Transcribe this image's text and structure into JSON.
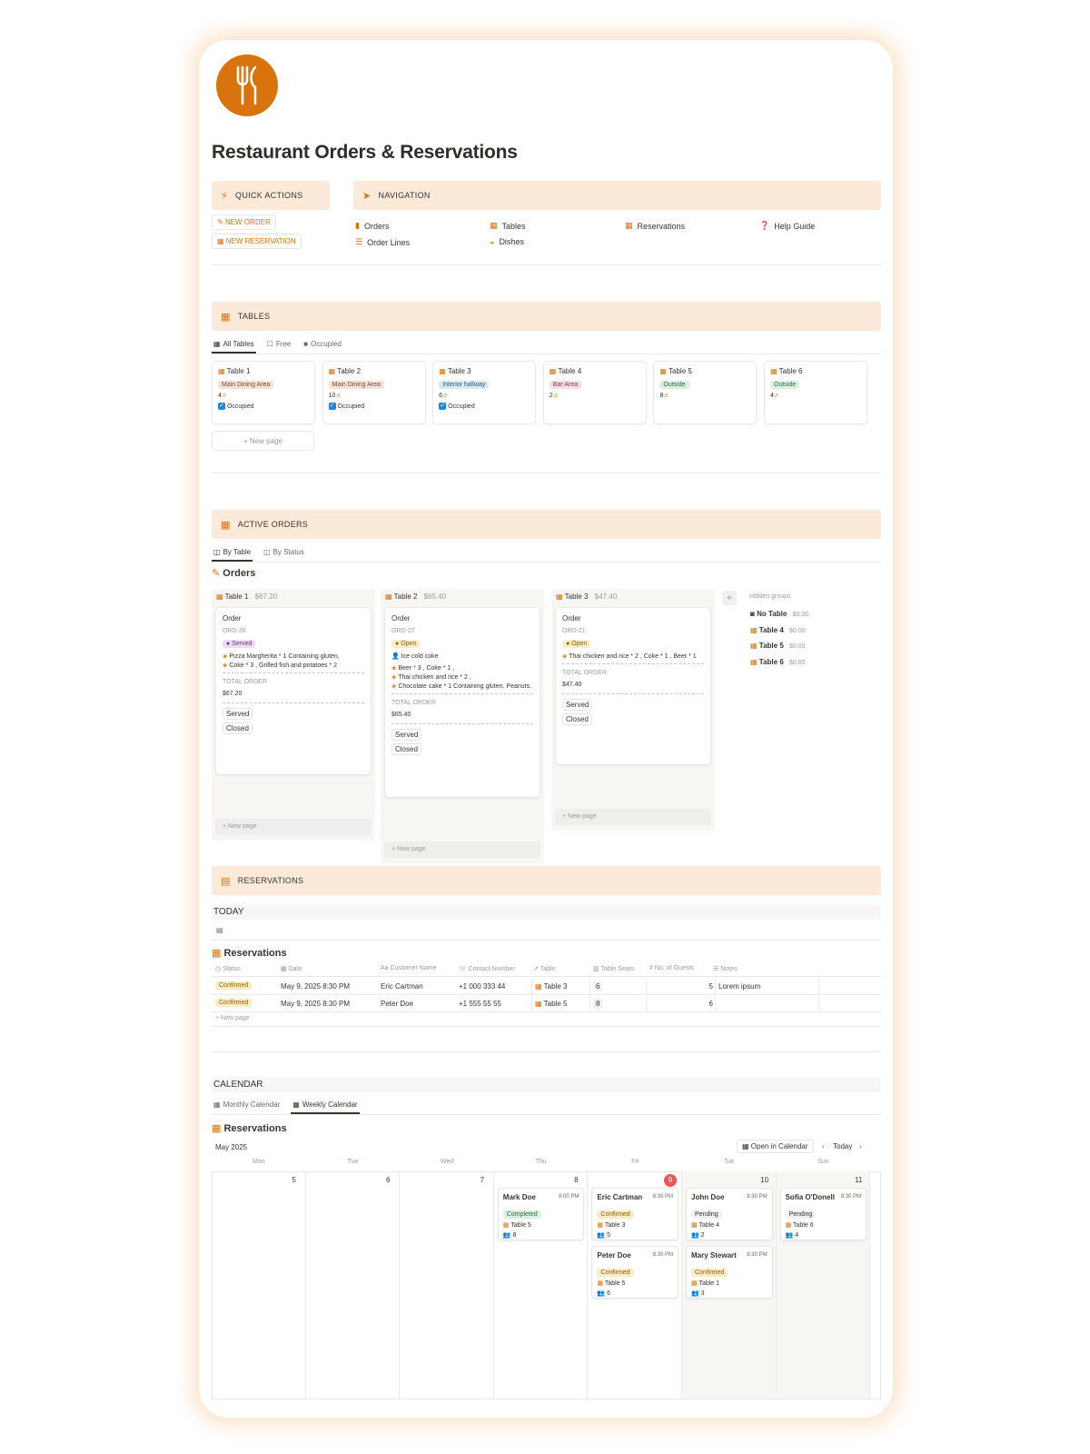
{
  "page": {
    "title": "Restaurant Orders & Reservations"
  },
  "colors": {
    "accent": "#d9730d",
    "section_bg": "#fbe9d9"
  },
  "quick_actions": {
    "title": "QUICK ACTIONS",
    "new_order": "NEW ORDER",
    "new_reservation": "NEW RESERVATION"
  },
  "navigation": {
    "title": "NAVIGATION",
    "orders": "Orders",
    "order_lines": "Order Lines",
    "tables": "Tables",
    "dishes": "Dishes",
    "reservations": "Reservations",
    "help": "Help Guide"
  },
  "tables": {
    "title": "TABLES",
    "tabs": [
      "All Tables",
      "Free",
      "Occupied"
    ],
    "new_page": "+ New page",
    "items": [
      {
        "name": "Table 1",
        "area": "Main Dining Area",
        "seats": "4",
        "occupied": "Occupied"
      },
      {
        "name": "Table 2",
        "area": "Main Dining Area",
        "seats": "10",
        "occupied": "Occupied"
      },
      {
        "name": "Table 3",
        "area": "Interior hallway",
        "seats": "6",
        "occupied": "Occupied"
      },
      {
        "name": "Table 4",
        "area": "Bar Area",
        "seats": "2",
        "occupied": ""
      },
      {
        "name": "Table 5",
        "area": "Outside",
        "seats": "8",
        "occupied": ""
      },
      {
        "name": "Table 6",
        "area": "Outside",
        "seats": "4",
        "occupied": ""
      }
    ]
  },
  "active_orders": {
    "title": "ACTIVE ORDERS",
    "tabs": [
      "By Table",
      "By Status"
    ],
    "db_title": "Orders",
    "new_page": "+ New page",
    "columns": [
      {
        "table": "Table 1",
        "sum": "$67.20",
        "order_label": "Order",
        "id": "ORD-26",
        "status": "Served",
        "lines": [
          "Pizza Margherita * 1 Containing gluten,",
          "Coke * 3 , Grilled fish and potatoes * 2"
        ],
        "customer": "",
        "total_label": "TOTAL ORDER",
        "total": "$67.20",
        "opt1": "Served",
        "opt2": "Closed"
      },
      {
        "table": "Table 2",
        "sum": "$65.40",
        "order_label": "Order",
        "id": "ORD-27",
        "status": "Open",
        "customer": "Ice cold coke",
        "lines": [
          "Beer * 3 , Coke * 1 ,",
          "Thai chicken and rice * 2 ,",
          "Chocolate cake * 1 Containing gluten. Peanuts."
        ],
        "total_label": "TOTAL ORDER",
        "total": "$65.40",
        "opt1": "Served",
        "opt2": "Closed"
      },
      {
        "table": "Table 3",
        "sum": "$47.40",
        "order_label": "Order",
        "id": "ORD-21",
        "status": "Open",
        "customer": "",
        "lines": [
          "Thai chicken and rice * 2 , Coke * 1 , Beer * 1"
        ],
        "total_label": "TOTAL ORDER",
        "total": "$47.40",
        "opt1": "Served",
        "opt2": "Closed"
      }
    ],
    "hidden": {
      "title": "Hidden groups",
      "items": [
        {
          "name": "No Table",
          "sum": "$0.00"
        },
        {
          "name": "Table 4",
          "sum": "$0.00"
        },
        {
          "name": "Table 5",
          "sum": "$0.00"
        },
        {
          "name": "Table 6",
          "sum": "$0.00"
        }
      ]
    }
  },
  "reservations": {
    "title": "RESERVATIONS",
    "today": "TODAY",
    "db_title": "Reservations",
    "headers": [
      "Status",
      "Date",
      "Customer Name",
      "Contact Number",
      "Table",
      "Table Seats",
      "No. of Guests",
      "Notes"
    ],
    "rows": [
      {
        "status": "Confirmed",
        "date": "May 9, 2025 8:30 PM",
        "name": "Eric Cartman",
        "phone": "+1 000 333 44",
        "table": "Table 3",
        "seats": "6",
        "guests": "5",
        "notes": "Lorem ipsum"
      },
      {
        "status": "Confirmed",
        "date": "May 9, 2025 8:30 PM",
        "name": "Peter Doe",
        "phone": "+1 555 55 55",
        "table": "Table 5",
        "seats": "8",
        "guests": "6",
        "notes": ""
      }
    ],
    "new_page": "+ New page"
  },
  "calendar": {
    "title": "CALENDAR",
    "tabs": [
      "Monthly Calendar",
      "Weekly Calendar"
    ],
    "db_title": "Reservations",
    "month": "May 2025",
    "open_in_calendar": "Open in Calendar",
    "today": "Today",
    "days": [
      "Mon",
      "Tue",
      "Wed",
      "Thu",
      "Fri",
      "Sat",
      "Sun"
    ],
    "dates": [
      "5",
      "6",
      "7",
      "8",
      "9",
      "10",
      "11"
    ],
    "events": [
      {
        "day": 3,
        "slot": 0,
        "name": "Mark Doe",
        "time": "8:00 PM",
        "status": "Completed",
        "table": "Table 5",
        "guests": "8"
      },
      {
        "day": 4,
        "slot": 0,
        "name": "Eric Cartman",
        "time": "8:30 PM",
        "status": "Confirmed",
        "table": "Table 3",
        "guests": "5"
      },
      {
        "day": 4,
        "slot": 1,
        "name": "Peter Doe",
        "time": "8:30 PM",
        "status": "Confirmed",
        "table": "Table 5",
        "guests": "6"
      },
      {
        "day": 5,
        "slot": 0,
        "name": "John Doe",
        "time": "8:30 PM",
        "status": "Pending",
        "table": "Table 4",
        "guests": "2"
      },
      {
        "day": 5,
        "slot": 1,
        "name": "Mary Stewart",
        "time": "8:30 PM",
        "status": "Confirmed",
        "table": "Table 1",
        "guests": "3"
      },
      {
        "day": 6,
        "slot": 0,
        "name": "Sofia O'Donell",
        "time": "8:30 PM",
        "status": "Pending",
        "table": "Table 6",
        "guests": "4"
      }
    ]
  }
}
